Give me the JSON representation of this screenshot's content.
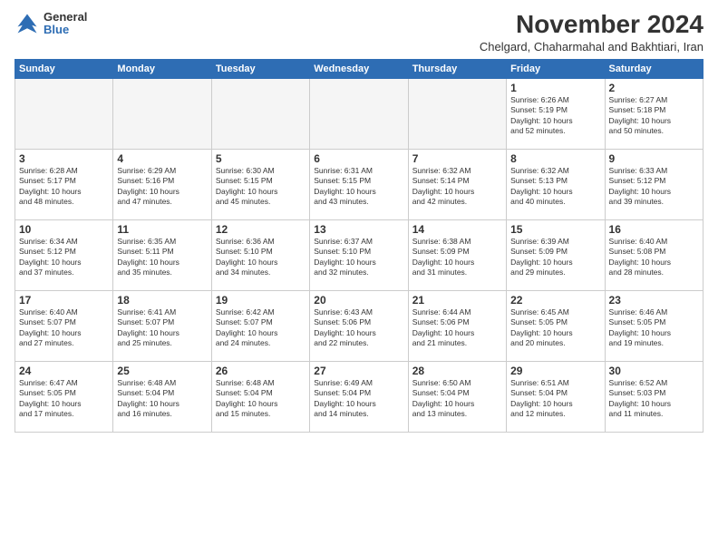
{
  "logo": {
    "general": "General",
    "blue": "Blue"
  },
  "title": "November 2024",
  "subtitle": "Chelgard, Chaharmahal and Bakhtiari, Iran",
  "headers": [
    "Sunday",
    "Monday",
    "Tuesday",
    "Wednesday",
    "Thursday",
    "Friday",
    "Saturday"
  ],
  "weeks": [
    [
      {
        "day": "",
        "info": "",
        "empty": true
      },
      {
        "day": "",
        "info": "",
        "empty": true
      },
      {
        "day": "",
        "info": "",
        "empty": true
      },
      {
        "day": "",
        "info": "",
        "empty": true
      },
      {
        "day": "",
        "info": "",
        "empty": true
      },
      {
        "day": "1",
        "info": "Sunrise: 6:26 AM\nSunset: 5:19 PM\nDaylight: 10 hours\nand 52 minutes."
      },
      {
        "day": "2",
        "info": "Sunrise: 6:27 AM\nSunset: 5:18 PM\nDaylight: 10 hours\nand 50 minutes."
      }
    ],
    [
      {
        "day": "3",
        "info": "Sunrise: 6:28 AM\nSunset: 5:17 PM\nDaylight: 10 hours\nand 48 minutes."
      },
      {
        "day": "4",
        "info": "Sunrise: 6:29 AM\nSunset: 5:16 PM\nDaylight: 10 hours\nand 47 minutes."
      },
      {
        "day": "5",
        "info": "Sunrise: 6:30 AM\nSunset: 5:15 PM\nDaylight: 10 hours\nand 45 minutes."
      },
      {
        "day": "6",
        "info": "Sunrise: 6:31 AM\nSunset: 5:15 PM\nDaylight: 10 hours\nand 43 minutes."
      },
      {
        "day": "7",
        "info": "Sunrise: 6:32 AM\nSunset: 5:14 PM\nDaylight: 10 hours\nand 42 minutes."
      },
      {
        "day": "8",
        "info": "Sunrise: 6:32 AM\nSunset: 5:13 PM\nDaylight: 10 hours\nand 40 minutes."
      },
      {
        "day": "9",
        "info": "Sunrise: 6:33 AM\nSunset: 5:12 PM\nDaylight: 10 hours\nand 39 minutes."
      }
    ],
    [
      {
        "day": "10",
        "info": "Sunrise: 6:34 AM\nSunset: 5:12 PM\nDaylight: 10 hours\nand 37 minutes."
      },
      {
        "day": "11",
        "info": "Sunrise: 6:35 AM\nSunset: 5:11 PM\nDaylight: 10 hours\nand 35 minutes."
      },
      {
        "day": "12",
        "info": "Sunrise: 6:36 AM\nSunset: 5:10 PM\nDaylight: 10 hours\nand 34 minutes."
      },
      {
        "day": "13",
        "info": "Sunrise: 6:37 AM\nSunset: 5:10 PM\nDaylight: 10 hours\nand 32 minutes."
      },
      {
        "day": "14",
        "info": "Sunrise: 6:38 AM\nSunset: 5:09 PM\nDaylight: 10 hours\nand 31 minutes."
      },
      {
        "day": "15",
        "info": "Sunrise: 6:39 AM\nSunset: 5:09 PM\nDaylight: 10 hours\nand 29 minutes."
      },
      {
        "day": "16",
        "info": "Sunrise: 6:40 AM\nSunset: 5:08 PM\nDaylight: 10 hours\nand 28 minutes."
      }
    ],
    [
      {
        "day": "17",
        "info": "Sunrise: 6:40 AM\nSunset: 5:07 PM\nDaylight: 10 hours\nand 27 minutes."
      },
      {
        "day": "18",
        "info": "Sunrise: 6:41 AM\nSunset: 5:07 PM\nDaylight: 10 hours\nand 25 minutes."
      },
      {
        "day": "19",
        "info": "Sunrise: 6:42 AM\nSunset: 5:07 PM\nDaylight: 10 hours\nand 24 minutes."
      },
      {
        "day": "20",
        "info": "Sunrise: 6:43 AM\nSunset: 5:06 PM\nDaylight: 10 hours\nand 22 minutes."
      },
      {
        "day": "21",
        "info": "Sunrise: 6:44 AM\nSunset: 5:06 PM\nDaylight: 10 hours\nand 21 minutes."
      },
      {
        "day": "22",
        "info": "Sunrise: 6:45 AM\nSunset: 5:05 PM\nDaylight: 10 hours\nand 20 minutes."
      },
      {
        "day": "23",
        "info": "Sunrise: 6:46 AM\nSunset: 5:05 PM\nDaylight: 10 hours\nand 19 minutes."
      }
    ],
    [
      {
        "day": "24",
        "info": "Sunrise: 6:47 AM\nSunset: 5:05 PM\nDaylight: 10 hours\nand 17 minutes."
      },
      {
        "day": "25",
        "info": "Sunrise: 6:48 AM\nSunset: 5:04 PM\nDaylight: 10 hours\nand 16 minutes."
      },
      {
        "day": "26",
        "info": "Sunrise: 6:48 AM\nSunset: 5:04 PM\nDaylight: 10 hours\nand 15 minutes."
      },
      {
        "day": "27",
        "info": "Sunrise: 6:49 AM\nSunset: 5:04 PM\nDaylight: 10 hours\nand 14 minutes."
      },
      {
        "day": "28",
        "info": "Sunrise: 6:50 AM\nSunset: 5:04 PM\nDaylight: 10 hours\nand 13 minutes."
      },
      {
        "day": "29",
        "info": "Sunrise: 6:51 AM\nSunset: 5:04 PM\nDaylight: 10 hours\nand 12 minutes."
      },
      {
        "day": "30",
        "info": "Sunrise: 6:52 AM\nSunset: 5:03 PM\nDaylight: 10 hours\nand 11 minutes."
      }
    ]
  ]
}
